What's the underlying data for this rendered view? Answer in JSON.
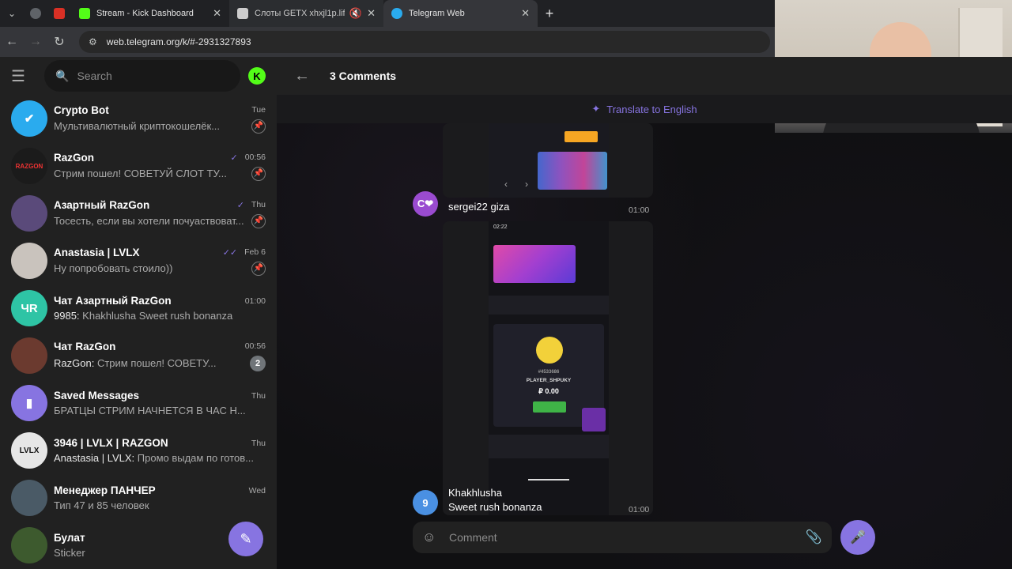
{
  "browser": {
    "tabs": [
      {
        "label": "Stream - Kick Dashboard",
        "favicon_color": "#53fc18"
      },
      {
        "label": "Слоты GETX xhxjl1p.life",
        "favicon_color": "#cccccc"
      },
      {
        "label": "Telegram Web",
        "favicon_color": "#2aabee"
      }
    ],
    "address": "web.telegram.org/k/#-2931327893"
  },
  "sidebar": {
    "search_placeholder": "Search",
    "chats": [
      {
        "name": "Crypto Bot",
        "time": "Tue",
        "message": "Мультивалютный криптокошелёк...",
        "avatar_color": "#2aabee",
        "avatar_text": "",
        "pinned": true
      },
      {
        "name": "RazGon",
        "time": "00:56",
        "message": "Стрим пошел! СОВЕТУЙ СЛОТ ТУ...",
        "avatar_color": "#1b1b1b",
        "avatar_text": "RAZGON",
        "pinned": true,
        "muted": true,
        "read": true
      },
      {
        "name": "Азартный RazGon",
        "time": "Thu",
        "message": "Тосесть, если вы хотели почуаствоват...",
        "avatar_color": "#5a4a7a",
        "avatar_text": "",
        "pinned": true,
        "read": true
      },
      {
        "name": "Anastasia | LVLX",
        "time": "Feb 6",
        "message": "Ну попробовать стоило))",
        "avatar_color": "#c9c3bd",
        "avatar_text": "",
        "pinned": true,
        "read": true
      },
      {
        "name": "Чат Азартный RazGon",
        "time": "01:00",
        "sender": "9985:",
        "message": "Khakhlusha Sweet rush bonanza",
        "avatar_color": "#2ec4a5",
        "avatar_text": "ЧR",
        "muted": true
      },
      {
        "name": "Чат RazGon",
        "time": "00:56",
        "sender": "RazGon:",
        "message": "Стрим пошел! СОВЕТУ...",
        "avatar_color": "#6b3a2f",
        "avatar_text": "",
        "badge": "2",
        "muted": true
      },
      {
        "name": "Saved Messages",
        "time": "Thu",
        "message": "БРАТЦЫ СТРИМ НАЧНЕТСЯ В ЧАС Н...",
        "avatar_color": "#8774e1",
        "avatar_text": "🔖"
      },
      {
        "name": "3946 | LVLX | RAZGON",
        "time": "Thu",
        "sender": "Anastasia | LVLX:",
        "message": "Промо выдам по готов...",
        "avatar_color": "#e6e6e6",
        "avatar_text": "LVLX"
      },
      {
        "name": "Менеджер ПАНЧЕР",
        "time": "Wed",
        "message": "Тип 47 и 85 человек",
        "avatar_color": "#4a5a66",
        "avatar_text": ""
      },
      {
        "name": "Булат",
        "time": "",
        "message": "Sticker",
        "avatar_color": "#3d5a2e",
        "avatar_text": ""
      }
    ]
  },
  "main": {
    "title": "3 Comments",
    "translate_label": "Translate to English",
    "messages": [
      {
        "author": "sergei22 giza",
        "time": "01:00",
        "avatar_text": "C❤",
        "avatar_color": "#9a4bd0"
      },
      {
        "author": "Khakhlusha",
        "text": "Sweet rush bonanza",
        "time": "01:00",
        "avatar_text": "9",
        "avatar_color": "#4a90e2"
      }
    ],
    "screenshot": {
      "player_name": "PLAYER_SHPUKY",
      "balance": "₽ 0.00",
      "player_id": "#4533686",
      "phone_time": "02:22"
    },
    "composer_placeholder": "Comment"
  }
}
